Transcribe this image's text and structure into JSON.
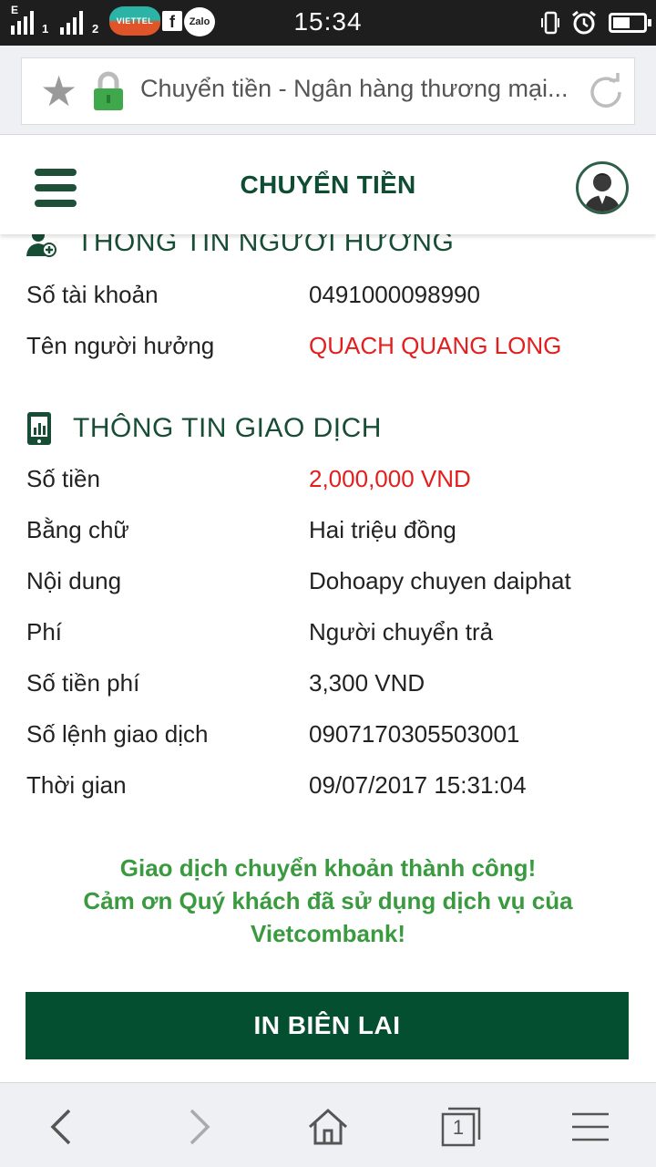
{
  "status_bar": {
    "time": "15:34",
    "network_label": "E",
    "sim1": "1",
    "sim2": "2",
    "carrier_logo_text": "VIETTEL",
    "zalo_label": "Zalo",
    "fb_label": "f",
    "battery_percent": 55,
    "icons": [
      "signal-icon",
      "facebook-icon",
      "zalo-icon",
      "vibrate-icon",
      "alarm-icon",
      "battery-icon"
    ]
  },
  "browser": {
    "url_title": "Chuyển tiền - Ngân hàng thương mại...",
    "icons": [
      "star-icon",
      "lock-icon",
      "reload-icon"
    ],
    "accent": "#3ea84a"
  },
  "header": {
    "title": "CHUYỂN TIỀN",
    "title_color": "#0f4d33"
  },
  "beneficiary": {
    "section_title": "THÔNG TIN NGƯỜI HƯỞNG",
    "rows": [
      {
        "label": "Số tài khoản",
        "value": "0491000098990"
      },
      {
        "label": "Tên người hưởng",
        "value": "QUACH QUANG LONG"
      }
    ]
  },
  "transaction": {
    "section_title": "THÔNG TIN GIAO DỊCH",
    "rows": [
      {
        "label": "Số tiền",
        "value": "2,000,000 VND"
      },
      {
        "label": "Bằng chữ",
        "value": "Hai triệu đồng"
      },
      {
        "label": "Nội dung",
        "value": "Dohoapy chuyen daiphat"
      },
      {
        "label": "Phí",
        "value": "Người chuyển trả"
      },
      {
        "label": "Số tiền phí",
        "value": "3,300 VND"
      },
      {
        "label": "Số lệnh giao dịch",
        "value": "0907170305503001"
      },
      {
        "label": "Thời gian",
        "value": "09/07/2017 15:31:04"
      }
    ]
  },
  "success_message": {
    "line1": "Giao dịch chuyển khoản thành công!",
    "line2": "Cảm ơn Quý khách đã sử dụng dịch vụ của",
    "line3": "Vietcombank!",
    "color": "#3a9a3f"
  },
  "print_button": {
    "label": "IN BIÊN LAI",
    "color": "#044f2f"
  },
  "bottom_nav": {
    "tab_count": "1",
    "icons": [
      "back-icon",
      "forward-icon",
      "home-icon",
      "tabs-icon",
      "menu-icon"
    ]
  }
}
